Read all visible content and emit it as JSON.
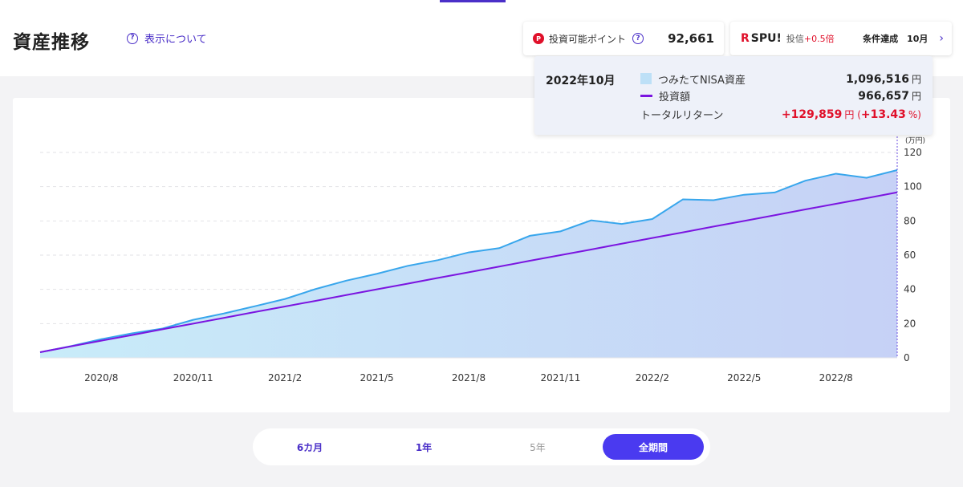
{
  "header": {
    "title": "資産推移",
    "help_link": "表示について",
    "help_icon": "question-circle-icon"
  },
  "points": {
    "badge": "P",
    "label": "投資可能ポイント",
    "value": "92,661"
  },
  "spu": {
    "logo_r": "R",
    "logo": "SPU!",
    "rate_prefix": "投信",
    "rate_value": "+0.5倍",
    "condition": "条件達成　10月",
    "chevron": "›"
  },
  "tooltip": {
    "date": "2022年10月",
    "asset_label": "つみたてNISA資産",
    "asset_value": "1,096,516",
    "invest_label": "投資額",
    "invest_value": "966,657",
    "return_label": "トータルリターン",
    "return_value": "+129,859",
    "return_open": "円 (",
    "return_pct": "+13.43",
    "return_close": "%)",
    "unit": "円"
  },
  "colors": {
    "asset_line": "#38a6ec",
    "invest_line": "#7b15e0",
    "accent": "#4a3af0"
  },
  "chart_data": {
    "type": "area",
    "y_unit_label": "(万円)",
    "ylim": [
      0,
      120
    ],
    "yticks": [
      0,
      20,
      40,
      60,
      80,
      100,
      120
    ],
    "grid": true,
    "x": [
      "2020/6",
      "2020/7",
      "2020/8",
      "2020/9",
      "2020/10",
      "2020/11",
      "2020/12",
      "2021/1",
      "2021/2",
      "2021/3",
      "2021/4",
      "2021/5",
      "2021/6",
      "2021/7",
      "2021/8",
      "2021/9",
      "2021/10",
      "2021/11",
      "2021/12",
      "2022/1",
      "2022/2",
      "2022/3",
      "2022/4",
      "2022/5",
      "2022/6",
      "2022/7",
      "2022/8",
      "2022/9",
      "2022/10"
    ],
    "xtick_labels": [
      "2020/8",
      "2020/11",
      "2021/2",
      "2021/5",
      "2021/8",
      "2021/11",
      "2022/2",
      "2022/5",
      "2022/8"
    ],
    "series": [
      {
        "name": "つみたてNISA資産",
        "kind": "area",
        "values": [
          3.3,
          6.8,
          10.9,
          14.3,
          17.1,
          22.2,
          25.9,
          30.1,
          34.4,
          40.2,
          45.1,
          49.1,
          53.7,
          57.1,
          61.6,
          64.1,
          71.3,
          73.9,
          80.3,
          78.2,
          81.1,
          92.6,
          92.1,
          95.3,
          96.6,
          103.5,
          107.6,
          105.2,
          109.7
        ]
      },
      {
        "name": "投資額",
        "kind": "line",
        "values": [
          3.3,
          6.7,
          10.0,
          13.3,
          16.7,
          20.0,
          23.3,
          26.7,
          30.0,
          33.3,
          36.7,
          40.0,
          43.3,
          46.7,
          50.0,
          53.3,
          56.7,
          60.0,
          63.3,
          66.7,
          70.0,
          73.3,
          76.7,
          80.0,
          83.3,
          86.7,
          90.0,
          93.3,
          96.7
        ]
      }
    ],
    "highlight_index": 28
  },
  "range": {
    "options": [
      {
        "label": "6カ月",
        "state": "normal"
      },
      {
        "label": "1年",
        "state": "normal"
      },
      {
        "label": "5年",
        "state": "disabled"
      },
      {
        "label": "全期間",
        "state": "active"
      }
    ]
  }
}
